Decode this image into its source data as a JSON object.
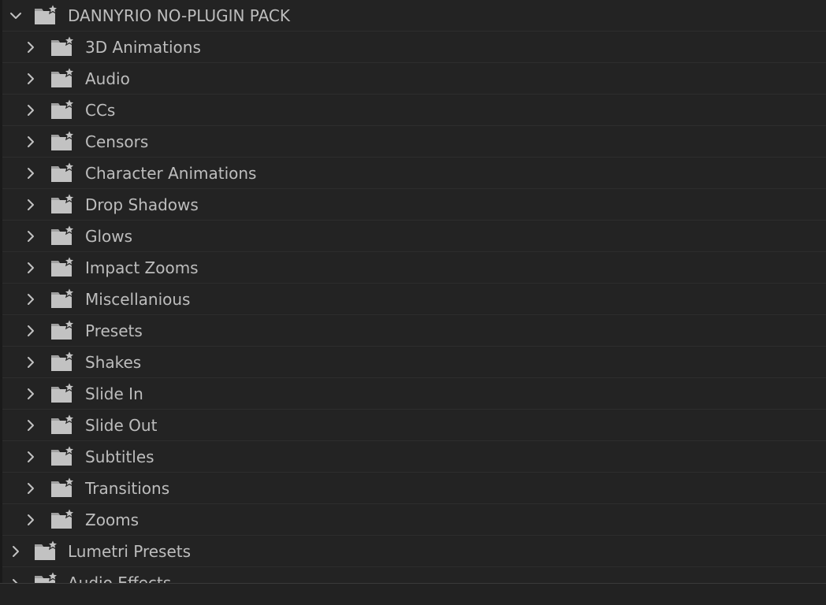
{
  "root": {
    "label": "DANNYRIO NO-PLUGIN PACK",
    "expanded": true,
    "icon": "bin-star-folder-icon",
    "children": [
      {
        "label": "3D Animations"
      },
      {
        "label": "Audio"
      },
      {
        "label": "CCs"
      },
      {
        "label": "Censors"
      },
      {
        "label": "Character Animations"
      },
      {
        "label": "Drop Shadows"
      },
      {
        "label": "Glows"
      },
      {
        "label": "Impact Zooms"
      },
      {
        "label": "Miscellanious"
      },
      {
        "label": "Presets"
      },
      {
        "label": "Shakes"
      },
      {
        "label": "Slide In"
      },
      {
        "label": "Slide Out"
      },
      {
        "label": "Subtitles"
      },
      {
        "label": "Transitions"
      },
      {
        "label": "Zooms"
      }
    ]
  },
  "siblings": [
    {
      "label": "Lumetri Presets",
      "expanded": false
    },
    {
      "label": "Audio Effects",
      "expanded": false
    }
  ],
  "colors": {
    "background": "#232323",
    "text": "#bdbdbd",
    "icon": "#c2c2c2",
    "separator": "#2d2d2d"
  }
}
